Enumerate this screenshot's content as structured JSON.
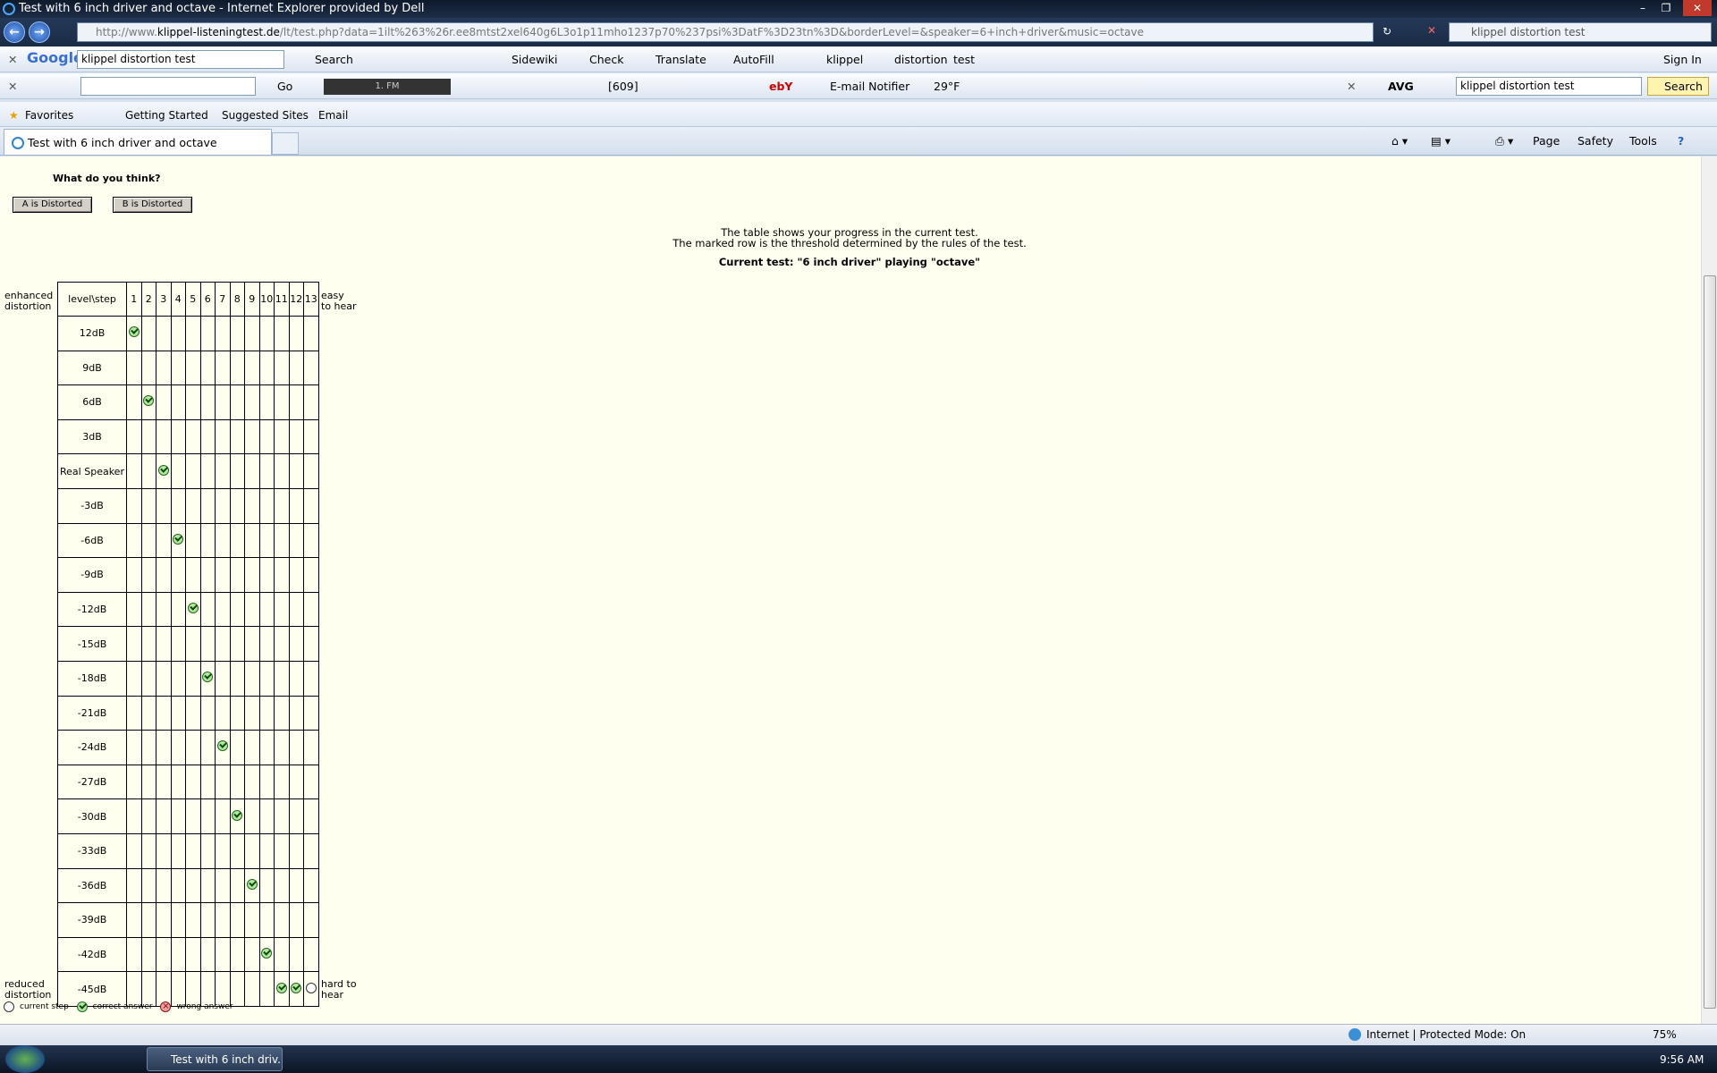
{
  "window": {
    "title": "Test with 6 inch driver and octave - Internet Explorer provided by Dell"
  },
  "address": {
    "url_prefix": "http://www.",
    "url_host": "klippel-listeningtest.de",
    "url_path": "/lt/test.php?data=1ilt%263%26r.ee8mtst2xel640g6L3o1p11mho1237p70%237psi%3DatF%3D23tn%3D&borderLevel=&speaker=6+inch+driver&music=octave",
    "search_value": "klippel distortion test"
  },
  "google_bar": {
    "logo": "Google",
    "search_value": "klippel distortion test",
    "items": [
      "Search",
      "Sidewiki",
      "Check",
      "Translate",
      "AutoFill",
      "klippel",
      "distortion",
      "test",
      "Sign In"
    ]
  },
  "second_bar": {
    "go": "Go",
    "radio": "1. FM",
    "count": "[609]",
    "email": "E-mail Notifier",
    "weather": "29°F",
    "avg": "AVG",
    "yahoo_search_value": "klippel distortion test",
    "search_button": "Search"
  },
  "favorites": {
    "favorites": "Favorites",
    "items": [
      "Getting Started",
      "Suggested Sites",
      "Email"
    ]
  },
  "tab": {
    "label": "Test with 6 inch driver and octave"
  },
  "commands": [
    "Page",
    "Safety",
    "Tools"
  ],
  "page": {
    "question": "What do you think?",
    "button_a": "A is Distorted",
    "button_b": "B is Distorted",
    "info_line1": "The table shows your progress in the current test.",
    "info_line2": "The marked row is the threshold determined by the rules of the test.",
    "current_test": "Current test: \"6 inch driver\" playing \"octave\"",
    "enhanced": "enhanced distortion",
    "reduced": "reduced distortion",
    "easy": "easy to hear",
    "hard": "hard to hear",
    "header_label": "level\\step",
    "steps": [
      "1",
      "2",
      "3",
      "4",
      "5",
      "6",
      "7",
      "8",
      "9",
      "10",
      "11",
      "12",
      "13"
    ],
    "levels": [
      "12dB",
      "9dB",
      "6dB",
      "3dB",
      "Real Speaker",
      "-3dB",
      "-6dB",
      "-9dB",
      "-12dB",
      "-15dB",
      "-18dB",
      "-21dB",
      "-24dB",
      "-27dB",
      "-30dB",
      "-33dB",
      "-36dB",
      "-39dB",
      "-42dB",
      "-45dB"
    ],
    "answers": [
      {
        "step": 1,
        "level": "12dB",
        "result": "correct"
      },
      {
        "step": 2,
        "level": "6dB",
        "result": "correct"
      },
      {
        "step": 3,
        "level": "Real Speaker",
        "result": "correct"
      },
      {
        "step": 4,
        "level": "-6dB",
        "result": "correct"
      },
      {
        "step": 5,
        "level": "-12dB",
        "result": "correct"
      },
      {
        "step": 6,
        "level": "-18dB",
        "result": "correct"
      },
      {
        "step": 7,
        "level": "-24dB",
        "result": "correct"
      },
      {
        "step": 8,
        "level": "-30dB",
        "result": "correct"
      },
      {
        "step": 9,
        "level": "-36dB",
        "result": "correct"
      },
      {
        "step": 10,
        "level": "-42dB",
        "result": "correct"
      },
      {
        "step": 11,
        "level": "-45dB",
        "result": "correct"
      },
      {
        "step": 12,
        "level": "-45dB",
        "result": "correct"
      },
      {
        "step": 13,
        "level": "-45dB",
        "result": "current"
      }
    ],
    "legend": {
      "current": "current step",
      "correct": "correct answer",
      "wrong": "wrong answer"
    }
  },
  "status": {
    "zone": "Internet | Protected Mode: On",
    "zoom": "75%"
  },
  "taskbar": {
    "task": "Test with 6 inch driv...",
    "time": "9:56 AM"
  }
}
